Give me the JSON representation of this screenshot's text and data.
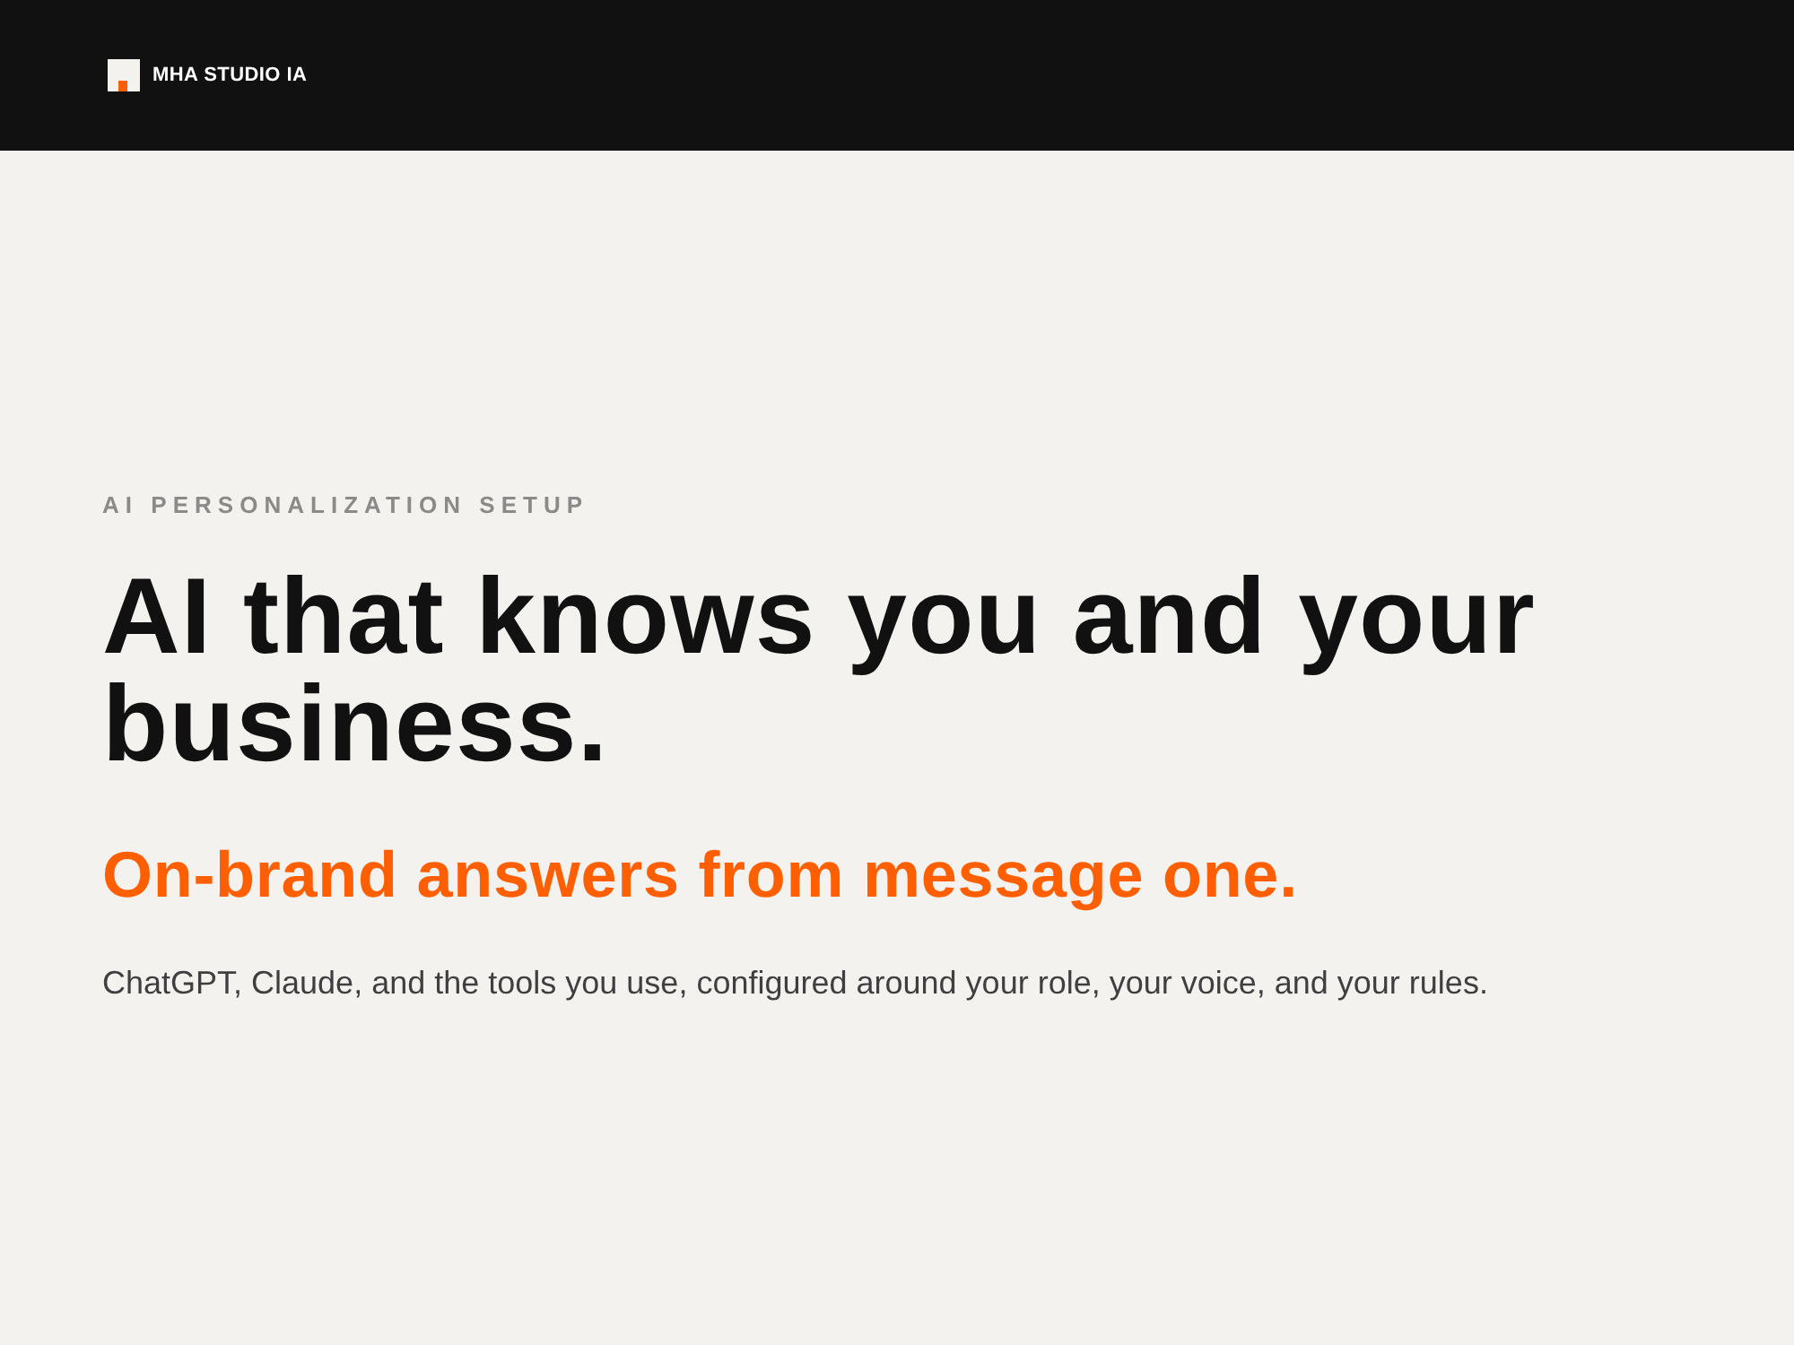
{
  "header": {
    "logo_text": "MHA STUDIO IA"
  },
  "hero": {
    "eyebrow": "AI PERSONALIZATION SETUP",
    "headline": "AI that knows you and your business.",
    "subheadline": "On-brand answers from message one.",
    "description": "ChatGPT, Claude, and the tools you use, configured around your role, your voice, and your rules."
  }
}
